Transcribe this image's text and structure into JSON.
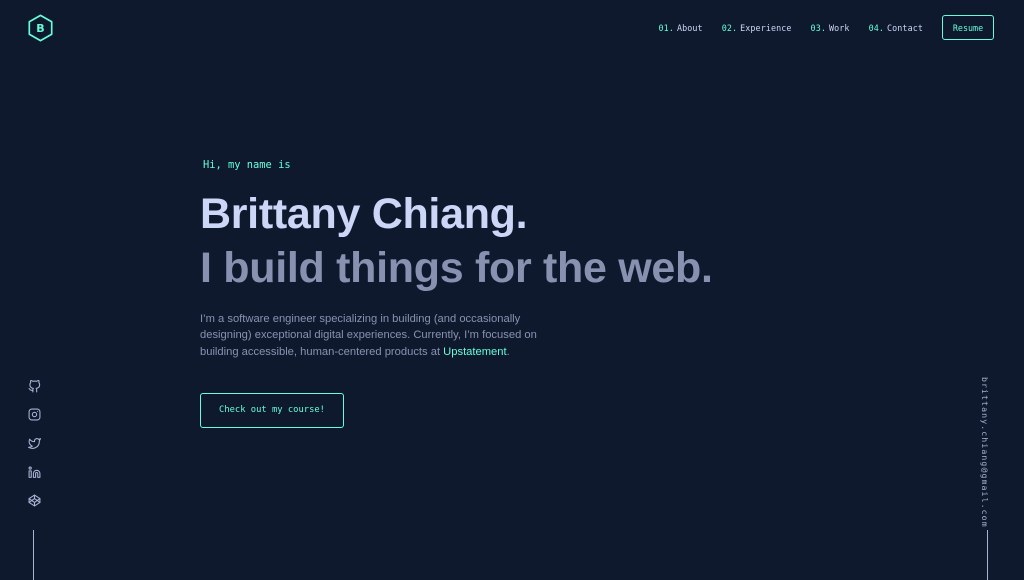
{
  "header": {
    "logo_letter": "B",
    "nav": [
      {
        "num": "01.",
        "label": "About"
      },
      {
        "num": "02.",
        "label": "Experience"
      },
      {
        "num": "03.",
        "label": "Work"
      },
      {
        "num": "04.",
        "label": "Contact"
      }
    ],
    "resume_label": "Resume"
  },
  "hero": {
    "greeting": "Hi, my name is",
    "name": "Brittany Chiang.",
    "tagline": "I build things for the web.",
    "bio_text": "I’m a software engineer specializing in building (and occasionally designing) exceptional digital experiences. Currently, I’m focused on building accessible, human-centered products at ",
    "bio_link": "Upstatement",
    "bio_end": ".",
    "cta_label": "Check out my course!"
  },
  "socials": [
    {
      "icon": "github-icon"
    },
    {
      "icon": "instagram-icon"
    },
    {
      "icon": "twitter-icon"
    },
    {
      "icon": "linkedin-icon"
    },
    {
      "icon": "codepen-icon"
    }
  ],
  "email": "brittany.chiang@gmail.com",
  "colors": {
    "background": "#0f192e",
    "accent": "#64ffda",
    "heading": "#ccd6f6",
    "text": "#8892b0"
  }
}
